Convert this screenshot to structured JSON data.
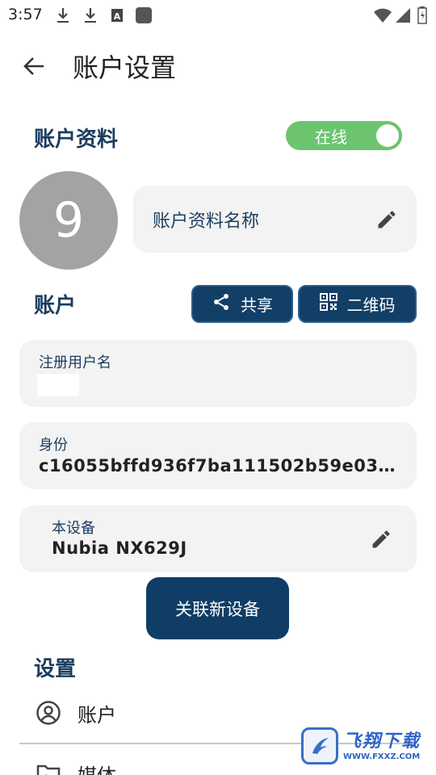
{
  "status_bar": {
    "time": "3:57",
    "icons": [
      "download-icon",
      "download-icon",
      "a-notification-icon",
      "app-notification-icon",
      "wifi-icon",
      "signal-icon",
      "battery-icon"
    ]
  },
  "header": {
    "title": "账户设置",
    "back_icon": "arrow-left-icon"
  },
  "profile": {
    "section_title": "账户资料",
    "status_label": "在线",
    "status_on": true,
    "avatar_text": "9",
    "name_placeholder": "账户资料名称",
    "edit_icon": "pencil-icon"
  },
  "account": {
    "section_title": "账户",
    "share_label": "共享",
    "share_icon": "share-icon",
    "qr_label": "二维码",
    "qr_icon": "qr-code-icon",
    "username_label": "注册用户名",
    "username_value": "",
    "identity_label": "身份",
    "identity_value": "c16055bffd936f7ba111502b59e03…",
    "device_label": "本设备",
    "device_value": "Nubia NX629J",
    "link_device_label": "关联新设备"
  },
  "settings": {
    "section_title": "设置",
    "items": [
      {
        "label": "账户",
        "icon": "account-circle-icon"
      },
      {
        "label": "媒体",
        "icon": "media-folder-icon"
      }
    ]
  },
  "watermark": {
    "text": "飞翔下载",
    "url": "WWW.FXXZ.COM"
  },
  "colors": {
    "primary": "#123f66",
    "heading": "#1b3d5f",
    "toggle_on": "#6cc46f",
    "card_bg": "#f3f3f3",
    "avatar_bg": "#a3a3a3"
  }
}
